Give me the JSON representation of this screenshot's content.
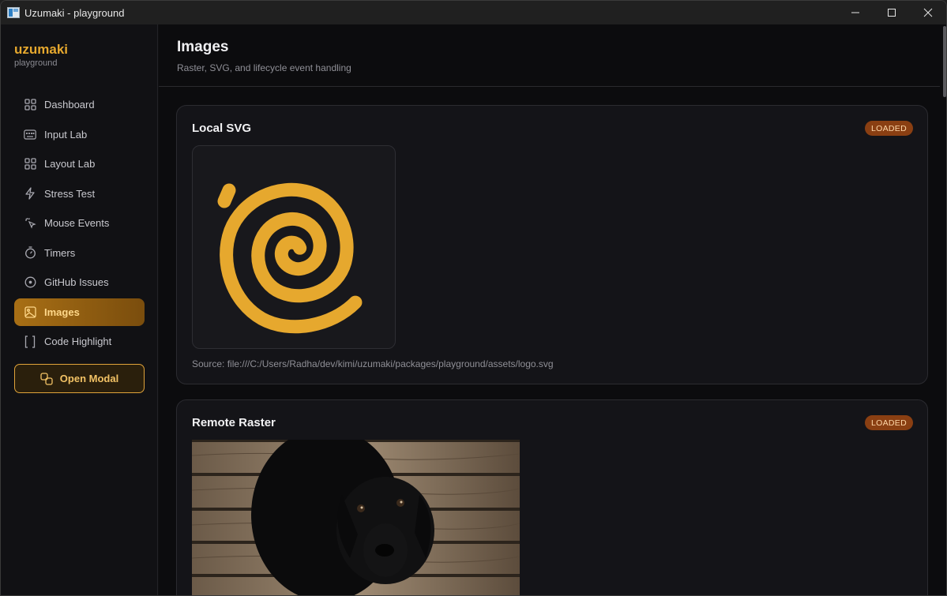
{
  "window": {
    "title": "Uzumaki - playground"
  },
  "sidebar": {
    "brand": "uzumaki",
    "subtitle": "playground",
    "items": [
      {
        "label": "Dashboard",
        "icon": "grid-icon"
      },
      {
        "label": "Input Lab",
        "icon": "keyboard-icon"
      },
      {
        "label": "Layout Lab",
        "icon": "layout-icon"
      },
      {
        "label": "Stress Test",
        "icon": "bolt-icon"
      },
      {
        "label": "Mouse Events",
        "icon": "pointer-click-icon"
      },
      {
        "label": "Timers",
        "icon": "stopwatch-icon"
      },
      {
        "label": "GitHub Issues",
        "icon": "issue-circle-icon"
      },
      {
        "label": "Images",
        "icon": "image-icon",
        "active": true
      },
      {
        "label": "Code Highlight",
        "icon": "brackets-icon"
      }
    ],
    "modal_button": "Open Modal"
  },
  "header": {
    "title": "Images",
    "subtitle": "Raster, SVG, and lifecycle event handling"
  },
  "cards": {
    "local_svg": {
      "title": "Local SVG",
      "status": "LOADED",
      "source": "Source: file:///C:/Users/Radha/dev/kimi/uzumaki/packages/playground/assets/logo.svg"
    },
    "remote_raster": {
      "title": "Remote Raster",
      "status": "LOADED"
    }
  },
  "colors": {
    "accent": "#e6a82e",
    "badge_bg": "#8a3f12",
    "background": "#0c0c0e"
  }
}
